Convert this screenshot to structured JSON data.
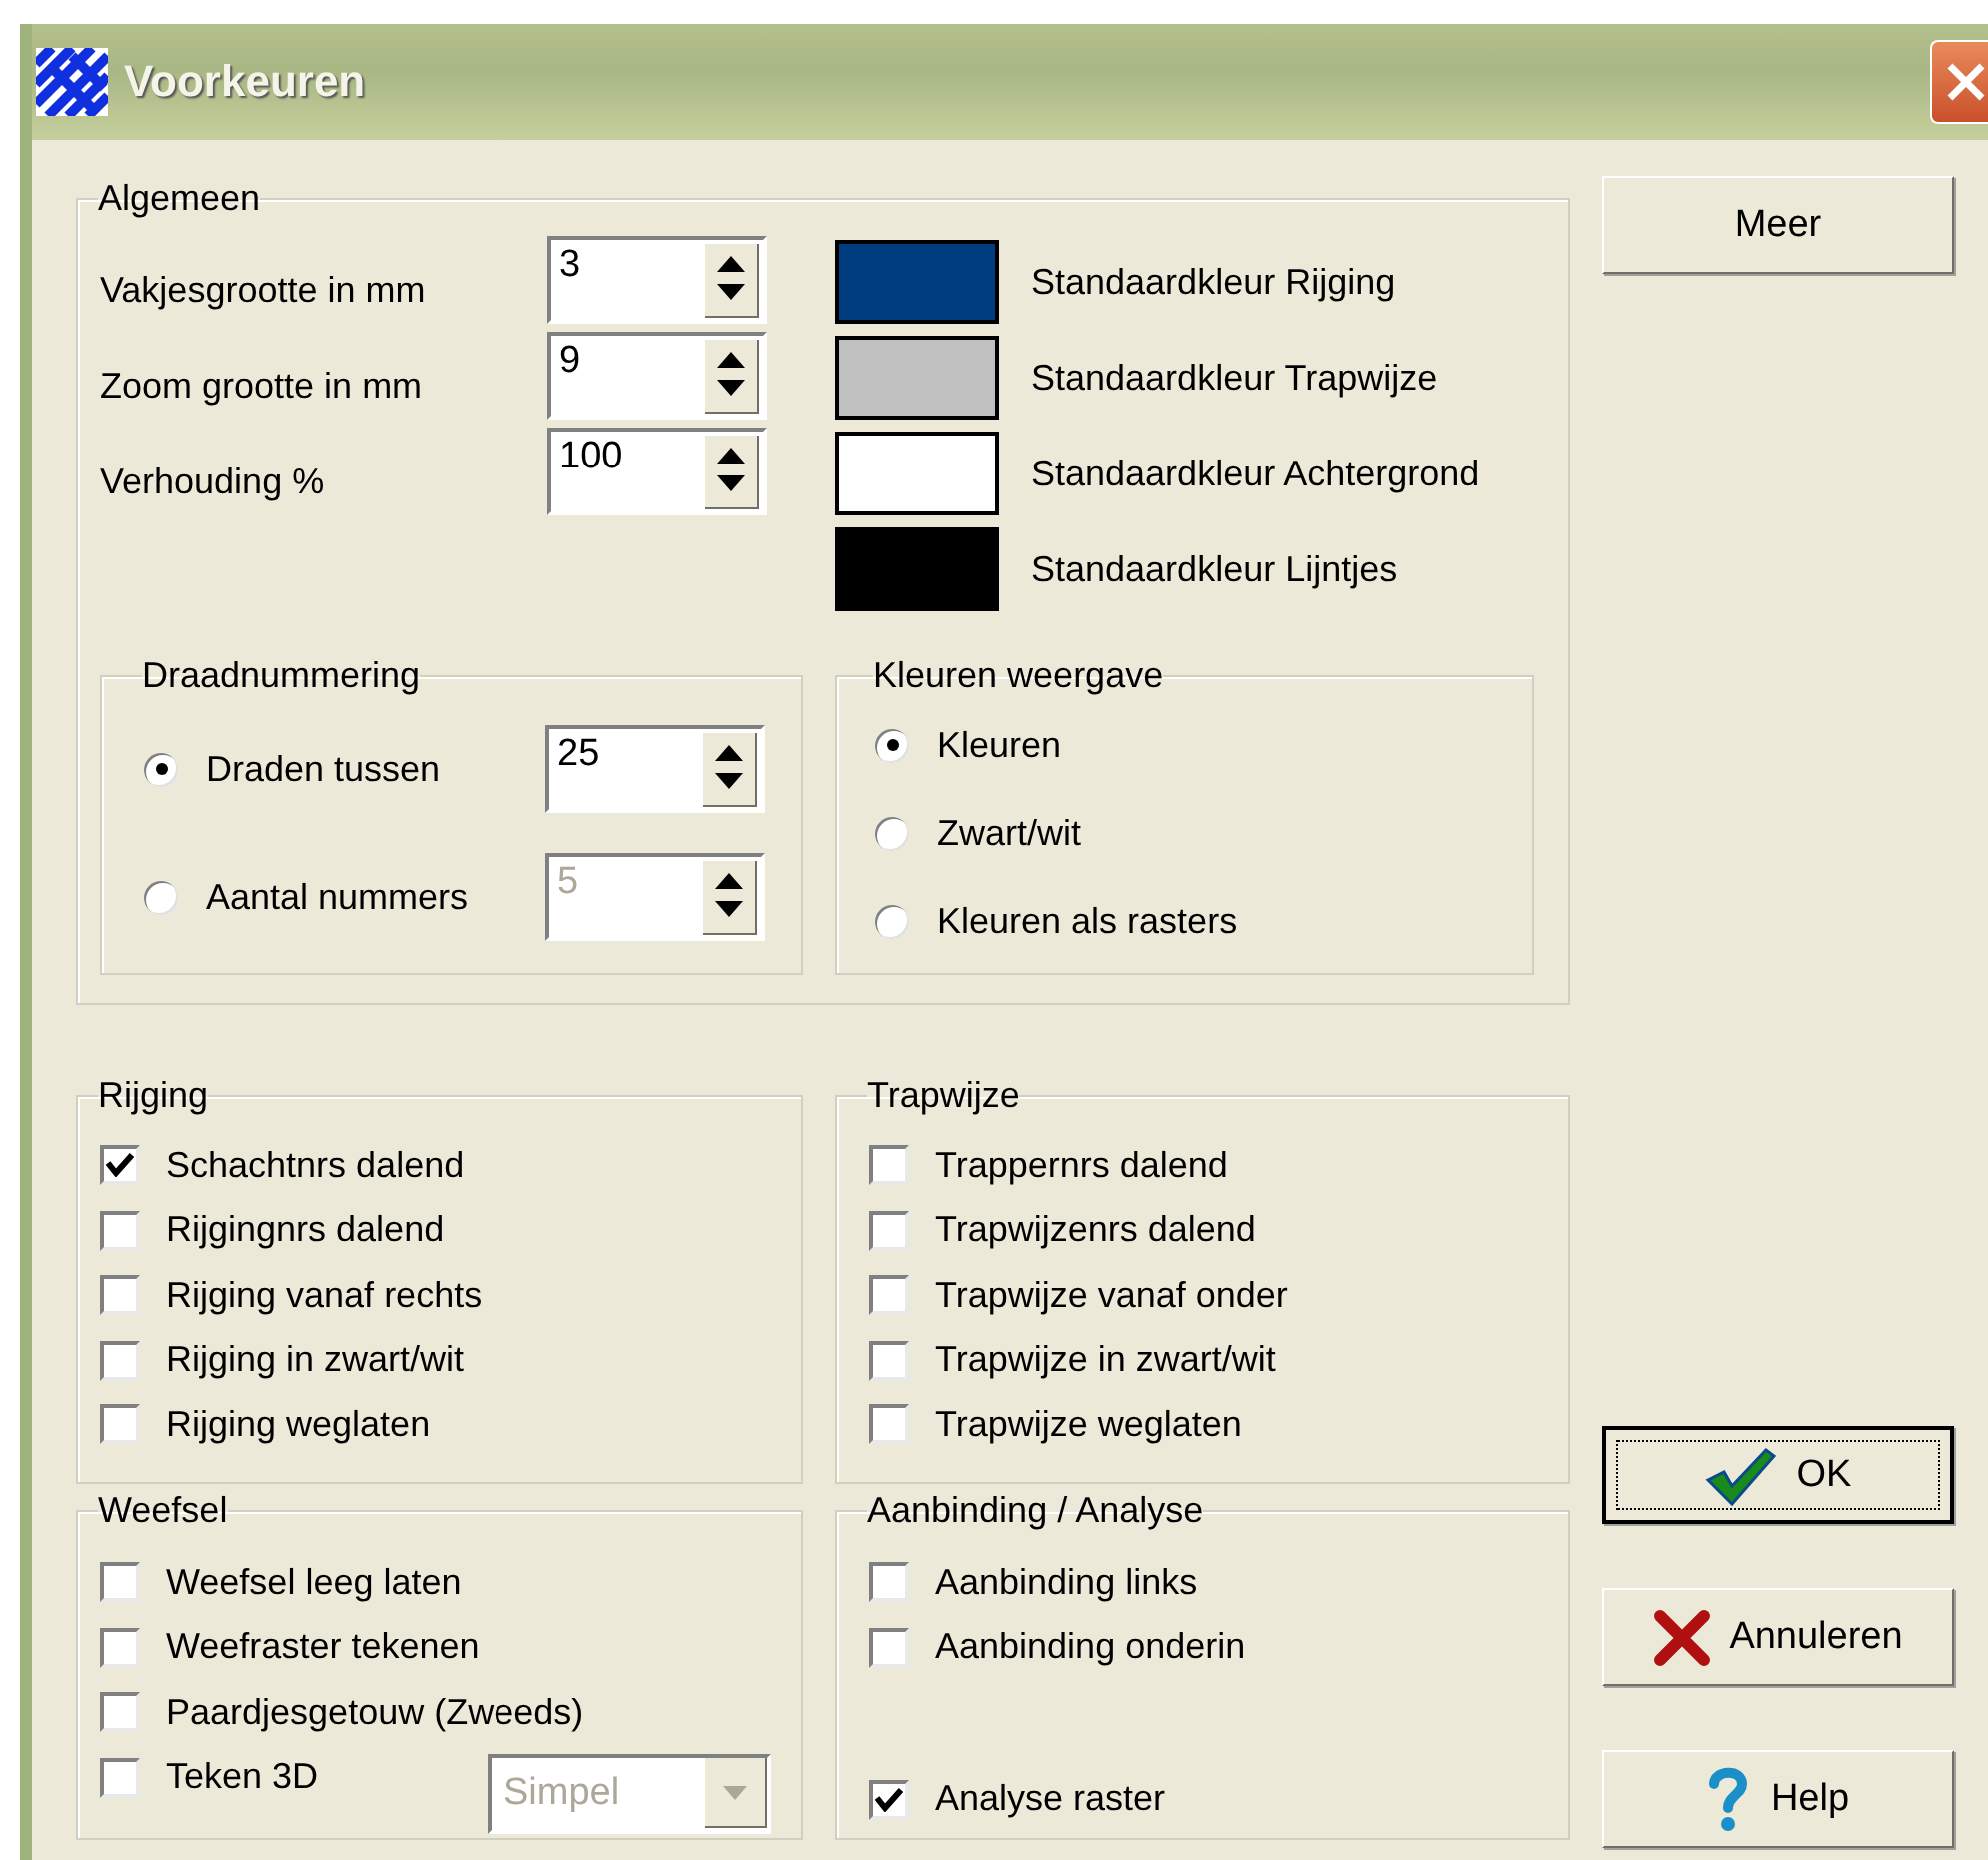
{
  "window": {
    "title": "Voorkeuren"
  },
  "algemeen": {
    "title": "Algemeen",
    "spinners": [
      {
        "label": "Vakjesgrootte in mm",
        "value": "3"
      },
      {
        "label": "Zoom grootte in mm",
        "value": "9"
      },
      {
        "label": "Verhouding %",
        "value": "100"
      }
    ],
    "colors": [
      {
        "label": "Standaardkleur Rijging",
        "color": "#003c80"
      },
      {
        "label": "Standaardkleur Trapwijze",
        "color": "#c0c0c0"
      },
      {
        "label": "Standaardkleur Achtergrond",
        "color": "#ffffff"
      },
      {
        "label": "Standaardkleur Lijntjes",
        "color": "#000000"
      }
    ],
    "draadnummering": {
      "title": "Draadnummering",
      "options": [
        {
          "label": "Draden tussen",
          "selected": true,
          "value": "25",
          "disabled": false
        },
        {
          "label": "Aantal nummers",
          "selected": false,
          "value": "5",
          "disabled": true
        }
      ]
    },
    "kleuren_weergave": {
      "title": "Kleuren weergave",
      "options": [
        {
          "label": "Kleuren",
          "selected": true
        },
        {
          "label": "Zwart/wit",
          "selected": false
        },
        {
          "label": "Kleuren als rasters",
          "selected": false
        }
      ]
    }
  },
  "groups": [
    {
      "title": "Rijging",
      "checkboxes": [
        {
          "label": "Schachtnrs dalend",
          "checked": true
        },
        {
          "label": "Rijgingnrs dalend",
          "checked": false
        },
        {
          "label": "Rijging vanaf rechts",
          "checked": false
        },
        {
          "label": "Rijging in zwart/wit",
          "checked": false
        },
        {
          "label": "Rijging weglaten",
          "checked": false
        }
      ]
    },
    {
      "title": "Trapwijze",
      "checkboxes": [
        {
          "label": "Trappernrs dalend",
          "checked": false
        },
        {
          "label": "Trapwijzenrs dalend",
          "checked": false
        },
        {
          "label": "Trapwijze vanaf onder",
          "checked": false
        },
        {
          "label": "Trapwijze in zwart/wit",
          "checked": false
        },
        {
          "label": "Trapwijze weglaten",
          "checked": false
        }
      ]
    },
    {
      "title": "Weefsel",
      "checkboxes": [
        {
          "label": "Weefsel leeg laten",
          "checked": false
        },
        {
          "label": "Weefraster tekenen",
          "checked": false
        },
        {
          "label": "Paardjesgetouw (Zweeds)",
          "checked": false
        },
        {
          "label": "Teken 3D",
          "checked": false
        }
      ],
      "dropdown": {
        "value": "Simpel",
        "disabled": true
      }
    },
    {
      "title": "Aanbinding / Analyse",
      "checkboxes": [
        {
          "label": "Aanbinding links",
          "checked": false
        },
        {
          "label": "Aanbinding onderin",
          "checked": false
        },
        {
          "label": "Analyse raster",
          "checked": true
        }
      ]
    }
  ],
  "buttons": [
    {
      "label": "Meer",
      "kind": "more",
      "focused": false
    },
    {
      "label": "OK",
      "kind": "ok",
      "focused": true
    },
    {
      "label": "Annuleren",
      "kind": "cancel",
      "focused": false
    },
    {
      "label": "Help",
      "kind": "help",
      "focused": false
    }
  ]
}
